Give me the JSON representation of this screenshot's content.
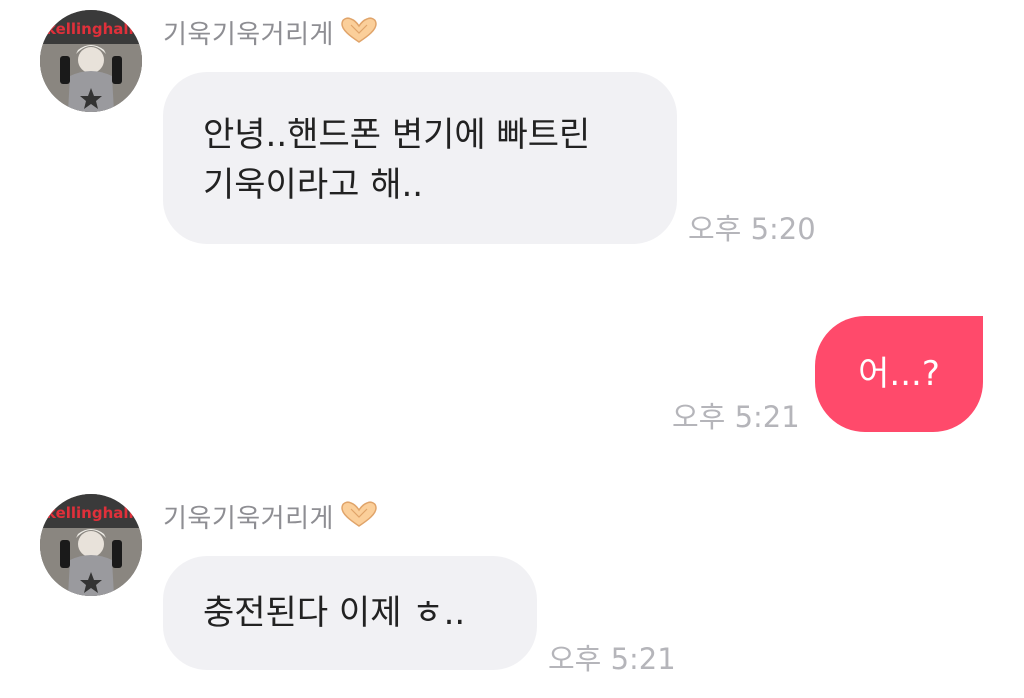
{
  "messages": [
    {
      "direction": "incoming",
      "sender": "기욱기욱거리게",
      "avatar_icon": "profile-photo",
      "lines": [
        "안녕..핸드폰 변기에 빠트린",
        "기욱이라고 해.."
      ],
      "time": "오후 5:20"
    },
    {
      "direction": "outgoing",
      "lines": [
        "어...?"
      ],
      "time": "오후 5:21"
    },
    {
      "direction": "incoming",
      "sender": "기욱기욱거리게",
      "avatar_icon": "profile-photo",
      "lines": [
        "충전된다 이제 ㅎ.."
      ],
      "time": "오후 5:21"
    }
  ],
  "colors": {
    "incoming_bubble": "#f1f1f4",
    "outgoing_bubble": "#ff4a6b",
    "name_text": "#8e8e93",
    "time_text": "#b5b5ba"
  },
  "icons": {
    "name_suffix": "heart-hands-icon"
  }
}
